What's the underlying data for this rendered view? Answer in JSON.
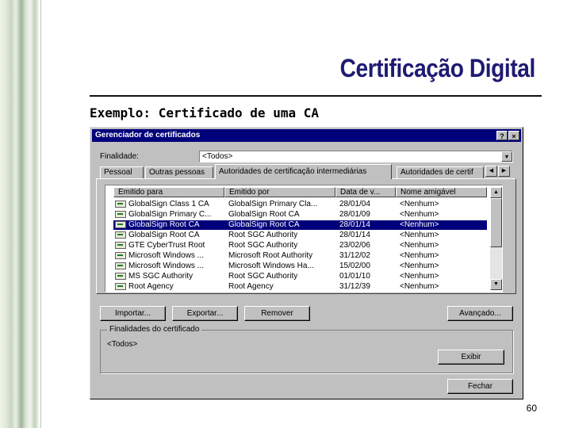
{
  "slide": {
    "title": "Certificação Digital",
    "subtitle": "Exemplo: Certificado de uma CA",
    "page_number": "60"
  },
  "dialog": {
    "title": "Gerenciador de certificados",
    "help_button": "?",
    "close_button": "×",
    "purpose_label": "Finalidade:",
    "purpose_value": "<Todos>",
    "tabs": [
      "Pessoal",
      "Outras pessoas",
      "Autoridades de certificação intermediárias",
      "Autoridades de certif"
    ],
    "active_tab": 2,
    "columns": [
      "Emitido para",
      "Emitido por",
      "Data de v...",
      "Nome amigável"
    ],
    "rows": [
      [
        "GlobalSign Class 1 CA",
        "GlobalSign Primary Cla...",
        "28/01/04",
        "<Nenhum>"
      ],
      [
        "GlobalSign Primary C...",
        "GlobalSign Root CA",
        "28/01/09",
        "<Nenhum>"
      ],
      [
        "GlobalSign Root CA",
        "GlobalSign Root CA",
        "28/01/14",
        "<Nenhum>"
      ],
      [
        "GlobalSign Root CA",
        "Root SGC Authority",
        "28/01/14",
        "<Nenhum>"
      ],
      [
        "GTE CyberTrust Root",
        "Root SGC Authority",
        "23/02/06",
        "<Nenhum>"
      ],
      [
        "Microsoft Windows ...",
        "Microsoft Root Authority",
        "31/12/02",
        "<Nenhum>"
      ],
      [
        "Microsoft Windows ...",
        "Microsoft Windows Ha...",
        "15/02/00",
        "<Nenhum>"
      ],
      [
        "MS SGC Authority",
        "Root SGC Authority",
        "01/01/10",
        "<Nenhum>"
      ],
      [
        "Root Agency",
        "Root Agency",
        "31/12/39",
        "<Nenhum>"
      ]
    ],
    "selected_row": 2,
    "buttons": {
      "import": "Importar...",
      "export": "Exportar...",
      "remove": "Remover",
      "advanced": "Avançado...",
      "view": "Exibir",
      "close": "Fechar"
    },
    "purposes_group_label": "Finalidades do certificado",
    "purposes_group_value": "<Todos>"
  },
  "colors": {
    "title": "#1f1a72",
    "dialog_face": "#c0c0c0",
    "titlebar": "#00007b",
    "selection": "#00007b"
  }
}
